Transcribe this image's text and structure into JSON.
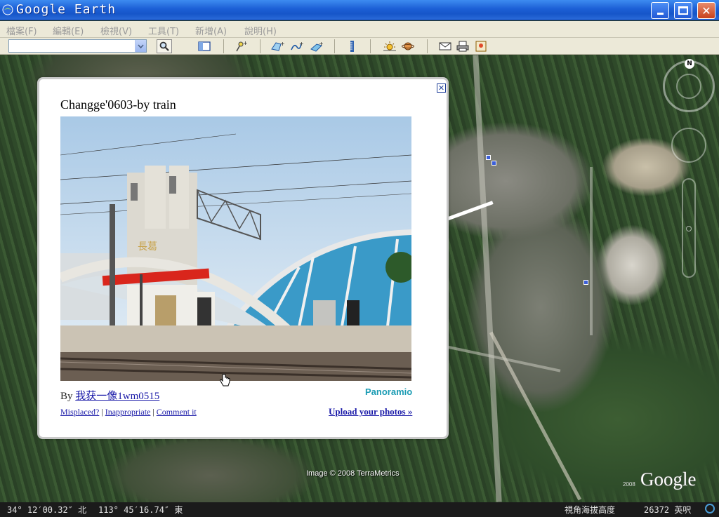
{
  "window": {
    "title": "Google Earth",
    "minimize_icon": "minimize-icon",
    "maximize_icon": "maximize-icon",
    "close_icon": "close-icon"
  },
  "menu": [
    {
      "label": "檔案(F)"
    },
    {
      "label": "編輯(E)"
    },
    {
      "label": "檢視(V)"
    },
    {
      "label": "工具(T)"
    },
    {
      "label": "新增(A)"
    },
    {
      "label": "說明(H)"
    }
  ],
  "toolbar": {
    "search_value": "",
    "icons": [
      "search-icon",
      "sidebar-icon",
      "placemark-icon",
      "polygon-icon",
      "path-icon",
      "image-overlay-icon",
      "ruler-icon",
      "sunlight-icon",
      "planet-icon",
      "email-icon",
      "print-icon",
      "maps-icon"
    ]
  },
  "balloon": {
    "title": "Changge'0603-by train",
    "photo_sign": "長葛",
    "by_prefix": "By",
    "author": "我获一像1wm0515",
    "brand": "Panoramio",
    "links": [
      "Misplaced?",
      "Inappropriate",
      "Comment it"
    ],
    "upload": "Upload your photos »"
  },
  "map": {
    "imagery_credit": "Image © 2008 TerraMetrics",
    "logo": "Google",
    "logo_year": "2008",
    "compass_letter": "N"
  },
  "status": {
    "latitude": "34° 12′00.32″ 北",
    "longitude": "113° 45′16.74″ 東",
    "eye_alt_label": "視角海拔高度",
    "eye_alt_value": "26372 英呎"
  },
  "colors": {
    "titlebar": "#1c5fd6",
    "link": "#1a1aa8",
    "panoramio": "#1c9cb4"
  }
}
